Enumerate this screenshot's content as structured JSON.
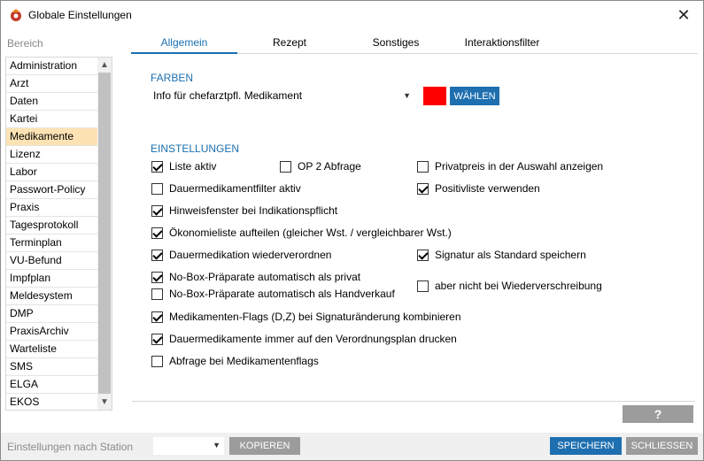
{
  "window": {
    "title": "Globale Einstellungen"
  },
  "sidebar": {
    "label": "Bereich",
    "items": [
      {
        "label": "Administration"
      },
      {
        "label": "Arzt"
      },
      {
        "label": "Daten"
      },
      {
        "label": "Kartei"
      },
      {
        "label": "Medikamente",
        "selected": true
      },
      {
        "label": "Lizenz"
      },
      {
        "label": "Labor"
      },
      {
        "label": "Passwort-Policy"
      },
      {
        "label": "Praxis"
      },
      {
        "label": "Tagesprotokoll"
      },
      {
        "label": "Terminplan"
      },
      {
        "label": "VU-Befund"
      },
      {
        "label": "Impfplan"
      },
      {
        "label": "Meldesystem"
      },
      {
        "label": "DMP"
      },
      {
        "label": "PraxisArchiv"
      },
      {
        "label": "Warteliste"
      },
      {
        "label": "SMS"
      },
      {
        "label": "ELGA"
      },
      {
        "label": "EKOS"
      }
    ]
  },
  "tabs": [
    {
      "label": "Allgemein",
      "active": true
    },
    {
      "label": "Rezept"
    },
    {
      "label": "Sonstiges"
    },
    {
      "label": "Interaktionsfilter"
    }
  ],
  "farben": {
    "heading": "FARBEN",
    "select_value": "Info für chefarztpfl. Medikament",
    "swatch_color": "#ff0000",
    "choose_label": "WÄHLEN"
  },
  "einstellungen": {
    "heading": "EINSTELLUNGEN",
    "options": {
      "liste_aktiv": {
        "label": "Liste aktiv",
        "checked": true
      },
      "op2_abfrage": {
        "label": "OP 2 Abfrage",
        "checked": false
      },
      "privatpreis": {
        "label": "Privatpreis in der Auswahl anzeigen",
        "checked": false
      },
      "dauermed_filter": {
        "label": "Dauermedikamentfilter aktiv",
        "checked": false
      },
      "positivliste": {
        "label": "Positivliste verwenden",
        "checked": true
      },
      "hinweisfenster": {
        "label": "Hinweisfenster bei Indikationspflicht",
        "checked": true
      },
      "oekonomieliste": {
        "label": "Ökonomieliste aufteilen (gleicher Wst. / vergleichbarer Wst.)",
        "checked": true
      },
      "dauermedikation": {
        "label": "Dauermedikation wiederverordnen",
        "checked": true
      },
      "signatur_standard": {
        "label": "Signatur als Standard speichern",
        "checked": true
      },
      "nobox_privat": {
        "label": "No-Box-Präparate automatisch als privat",
        "checked": true
      },
      "nobox_handverkauf": {
        "label": "No-Box-Präparate automatisch als Handverkauf",
        "checked": false
      },
      "nicht_wiederverschreibung": {
        "label": "aber nicht bei Wiederverschreibung",
        "checked": false
      },
      "flags_kombinieren": {
        "label": "Medikamenten-Flags (D,Z) bei Signaturänderung kombinieren",
        "checked": true
      },
      "verordnungsplan": {
        "label": "Dauermedikamente immer auf den Verordnungsplan drucken",
        "checked": true
      },
      "abfrage_flags": {
        "label": "Abfrage bei Medikamentenflags",
        "checked": false
      }
    }
  },
  "help_label": "?",
  "footer": {
    "station_label": "Einstellungen nach Station",
    "station_value": "",
    "copy_label": "KOPIEREN",
    "save_label": "SPEICHERN",
    "close_label": "SCHLIESSEN"
  },
  "colors": {
    "accent": "#1a6fb0",
    "selected_row": "#fde3b3",
    "gray_button": "#9c9c9c"
  }
}
